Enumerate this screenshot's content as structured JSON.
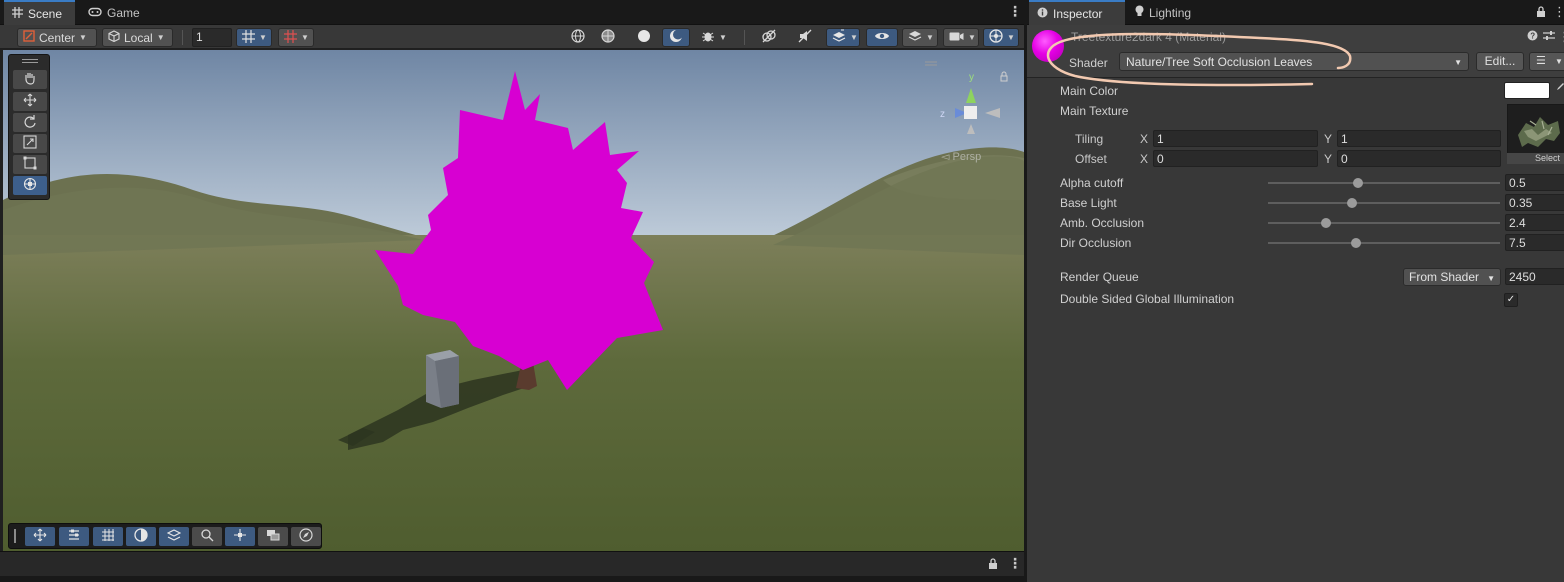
{
  "scene_window": {
    "tabs": [
      {
        "label": "Scene",
        "icon": "grid-icon",
        "active": true
      },
      {
        "label": "Game",
        "icon": "gamepad-icon",
        "active": false
      }
    ],
    "toolbar": {
      "pivot_label": "Center",
      "space_label": "Local",
      "snap_value": "1"
    },
    "overlay_label": "Persp",
    "accent_color": "#3d5a80"
  },
  "inspector_window": {
    "tabs": [
      {
        "label": "Inspector",
        "icon": "info-icon",
        "active": true
      },
      {
        "label": "Lighting",
        "icon": "lightbulb-icon",
        "active": false
      }
    ],
    "material": {
      "title": "Treetexture2dark 4 (Material)",
      "shader_label": "Shader",
      "shader_value": "Nature/Tree Soft Occlusion Leaves",
      "edit_label": "Edit...",
      "preview_color": "#e400e4"
    },
    "properties": {
      "main_color_label": "Main Color",
      "main_color_value": "#ffffff",
      "main_texture_label": "Main Texture",
      "tiling_label": "Tiling",
      "offset_label": "Offset",
      "x_letter": "X",
      "y_letter": "Y",
      "tiling_x": "1",
      "tiling_y": "1",
      "offset_x": "0",
      "offset_y": "0",
      "texture_select_label": "Select"
    },
    "sliders": [
      {
        "label": "Alpha cutoff",
        "value": "0.5",
        "fraction": 0.39
      },
      {
        "label": "Base Light",
        "value": "0.35",
        "fraction": 0.36
      },
      {
        "label": "Amb. Occlusion",
        "value": "2.4",
        "fraction": 0.25
      },
      {
        "label": "Dir Occlusion",
        "value": "7.5",
        "fraction": 0.38
      }
    ],
    "render_queue": {
      "label": "Render Queue",
      "mode": "From Shader",
      "value": "2450"
    },
    "double_sided": {
      "label": "Double Sided Global Illumination",
      "checked": true
    }
  }
}
